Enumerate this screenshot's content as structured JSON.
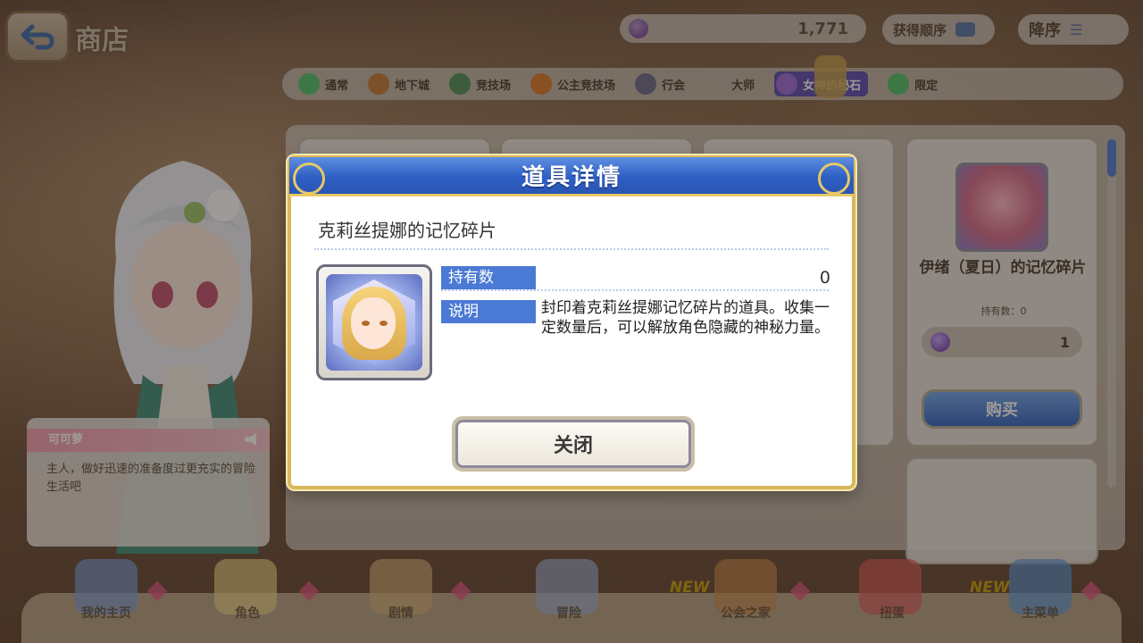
{
  "header": {
    "shop_title": "商店",
    "currency_amount": "1,771",
    "filter_label": "获得顺序",
    "sort_label": "降序"
  },
  "tabs": [
    {
      "label": "通常"
    },
    {
      "label": "地下城"
    },
    {
      "label": "竞技场"
    },
    {
      "label": "公主竞技场"
    },
    {
      "label": "行会"
    },
    {
      "label": "大师"
    },
    {
      "label": "女神的秘石"
    },
    {
      "label": "限定"
    }
  ],
  "shop_card": {
    "name": "伊绪（夏日）的记忆碎片",
    "owned_label": "持有数：0",
    "price": "1",
    "buy_label": "购买"
  },
  "character_dialog": {
    "name": "可可萝",
    "text": "主人，做好迅速的准备度过更充实的冒险生活吧"
  },
  "bottom_nav": [
    {
      "label": "我的主页"
    },
    {
      "label": "角色"
    },
    {
      "label": "剧情"
    },
    {
      "label": "冒险"
    },
    {
      "label": "公会之家"
    },
    {
      "label": "扭蛋"
    },
    {
      "label": "主菜单"
    }
  ],
  "new_badge": "NEW",
  "modal": {
    "title": "道具详情",
    "item_name": "克莉丝提娜的记忆碎片",
    "owned_label": "持有数",
    "owned_value": "0",
    "desc_label": "说明",
    "description": "封印着克莉丝提娜记忆碎片的道具。收集一定数量后，可以解放角色隐藏的神秘力量。",
    "close_label": "关闭"
  },
  "colors": {
    "modal_header": "#2e5fc4",
    "label_chip": "#4a7ad4",
    "frame_gold": "#d8b85a"
  }
}
